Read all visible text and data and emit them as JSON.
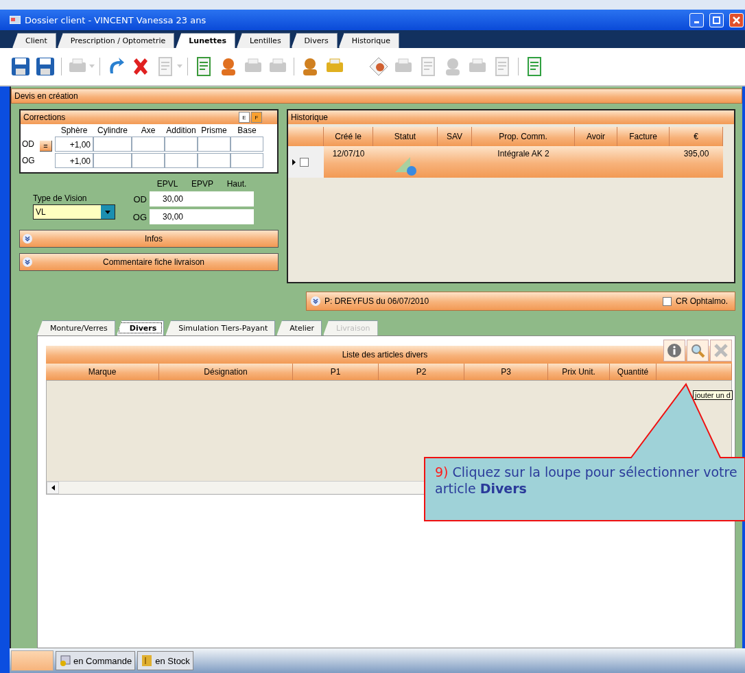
{
  "window": {
    "title": "Dossier client - VINCENT Vanessa 23 ans"
  },
  "tabs": [
    {
      "label": "Client",
      "selected": false
    },
    {
      "label": "Prescription / Optometrie",
      "selected": false
    },
    {
      "label": "Lunettes",
      "selected": true
    },
    {
      "label": "Lentilles",
      "selected": false
    },
    {
      "label": "Divers",
      "selected": false
    },
    {
      "label": "Historique",
      "selected": false
    }
  ],
  "toolbar": [
    {
      "kind": "save",
      "disabled": false
    },
    {
      "kind": "save-exit",
      "disabled": false
    },
    {
      "kind": "separator"
    },
    {
      "kind": "print",
      "disabled": true,
      "dropdown": true
    },
    {
      "kind": "separator"
    },
    {
      "kind": "redo",
      "disabled": false
    },
    {
      "kind": "delete",
      "disabled": false
    },
    {
      "kind": "copy",
      "disabled": true,
      "dropdown": true
    },
    {
      "kind": "separator"
    },
    {
      "kind": "report",
      "disabled": false
    },
    {
      "kind": "people",
      "disabled": false
    },
    {
      "kind": "cards",
      "disabled": true
    },
    {
      "kind": "eye",
      "disabled": true
    },
    {
      "kind": "separator"
    },
    {
      "kind": "hand",
      "disabled": false
    },
    {
      "kind": "basket",
      "disabled": false
    },
    {
      "kind": "gap"
    },
    {
      "kind": "letter",
      "disabled": false
    },
    {
      "kind": "tools",
      "disabled": true
    },
    {
      "kind": "document",
      "disabled": true
    },
    {
      "kind": "search-doc",
      "disabled": true
    },
    {
      "kind": "register",
      "disabled": true
    },
    {
      "kind": "document",
      "disabled": true
    },
    {
      "kind": "separator"
    },
    {
      "kind": "exit",
      "disabled": false
    }
  ],
  "quote_bar": {
    "title": "Devis en création"
  },
  "corrections": {
    "title": "Corrections",
    "modes": [
      {
        "label": "E",
        "selected": false
      },
      {
        "label": "F",
        "selected": true
      }
    ],
    "columns": [
      "Sphère",
      "Cylindre",
      "Axe",
      "Addition",
      "Prisme",
      "Base"
    ],
    "copy_button": "=",
    "rows": [
      {
        "eye": "OD",
        "sphere": "+1,00"
      },
      {
        "eye": "OG",
        "sphere": "+1,00"
      }
    ]
  },
  "vision": {
    "label": "Type de Vision",
    "value": "VL"
  },
  "pupil": {
    "columns": [
      "EPVL",
      "EPVP",
      "Haut."
    ],
    "rows": [
      {
        "eye": "OD",
        "epvl": "30,00"
      },
      {
        "eye": "OG",
        "epvl": "30,00"
      }
    ]
  },
  "sections": [
    {
      "label": "Infos",
      "expanded": false
    },
    {
      "label": "Commentaire fiche livraison",
      "expanded": false
    }
  ],
  "history": {
    "title": "Historique",
    "columns": [
      "Créé le",
      "Statut",
      "SAV",
      "Prop. Comm.",
      "Avoir",
      "Facture",
      "€"
    ],
    "rows": [
      {
        "current": true,
        "checked": false,
        "created": "12/07/10",
        "prop_comm": "Intégrale AK 2",
        "amount": "395,00"
      }
    ]
  },
  "prescription_bar": {
    "label": "P: DREYFUS du 06/07/2010",
    "expanded": false,
    "cr_label": "CR Ophtalmo.",
    "cr_checked": false
  },
  "sub_tabs": [
    {
      "label": "Monture/Verres",
      "selected": false,
      "disabled": false
    },
    {
      "label": "Divers",
      "selected": true,
      "disabled": false
    },
    {
      "label": "Simulation Tiers-Payant",
      "selected": false,
      "disabled": false
    },
    {
      "label": "Atelier",
      "selected": false,
      "disabled": false
    },
    {
      "label": "Livraison",
      "selected": false,
      "disabled": true
    }
  ],
  "articles": {
    "title": "Liste des articles divers",
    "actions": [
      {
        "kind": "info",
        "disabled": false
      },
      {
        "kind": "search",
        "disabled": false
      },
      {
        "kind": "delete",
        "disabled": true
      }
    ],
    "columns": [
      "Marque",
      "Désignation",
      "P1",
      "P2",
      "P3",
      "Prix Unit.",
      "Quantité"
    ],
    "tooltip": "jouter un d"
  },
  "callout": {
    "step": "9)",
    "text": "Cliquez sur la loupe pour sélectionner votre article **Divers**"
  },
  "status_bar": [
    {
      "kind": "order",
      "label": "en Commande"
    },
    {
      "kind": "stock",
      "label": "en Stock"
    }
  ]
}
